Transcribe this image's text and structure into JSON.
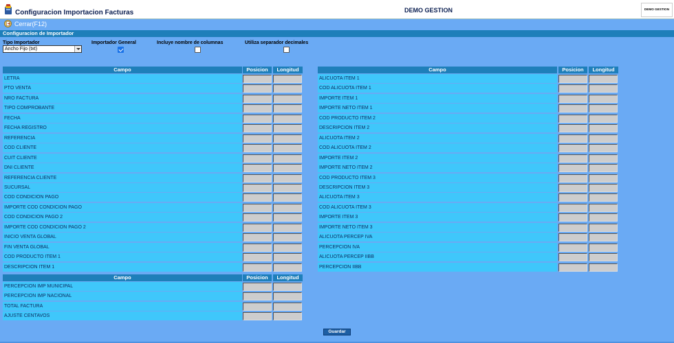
{
  "header": {
    "title": "Configuracion Importacion Facturas",
    "company": "DEMO GESTION",
    "logo_text": "DEMO GESTION"
  },
  "toolbar": {
    "close_label": "Cerrar(F12)"
  },
  "section": {
    "title": "Configuracion de Importador"
  },
  "options": {
    "tipo_label": "Tipo Importador",
    "tipo_value": "Ancho Fijo (txt)",
    "general_label": "Importador General",
    "general_checked": true,
    "columnas_label": "Incluye nombre de columnas",
    "columnas_checked": false,
    "separador_label": "Utiliza separador decimales",
    "separador_checked": false
  },
  "columns": {
    "campo": "Campo",
    "posicion": "Posicion",
    "longitud": "Longitud"
  },
  "left_table": {
    "rows": [
      "LETRA",
      "PTO VENTA",
      "NRO FACTURA",
      "TIPO COMPROBANTE",
      "FECHA",
      "FECHA REGISTRO",
      "REFERENCIA",
      "COD CLIENTE",
      "CUIT CLIENTE",
      "DNI CLIENTE",
      "REFERENCIA CLIENTE",
      "SUCURSAL",
      "COD CONDICION PAGO",
      "IMPORTE COD CONDICION PAGO",
      "COD CONDICION PAGO 2",
      "IMPORTE COD CONDICION PAGO 2",
      "INICIO VENTA GLOBAL",
      "FIN VENTA GLOBAL",
      "COD PRODUCTO ITEM 1",
      "DESCRIPCION ITEM 1"
    ]
  },
  "bottom_table": {
    "rows": [
      "PERCEPCION IMP MUNICIPAL",
      "PERCEPCION IMP NACIONAL",
      "TOTAL FACTURA",
      "AJUSTE CENTAVOS"
    ]
  },
  "right_table": {
    "rows": [
      "ALICUOTA ITEM 1",
      "COD ALICUOTA ITEM 1",
      "IMPORTE ITEM 1",
      "IMPORTE NETO ITEM 1",
      "COD PRODUCTO ITEM 2",
      "DESCRIPCION ITEM 2",
      "ALICUOTA ITEM 2",
      "COD ALICUOTA ITEM 2",
      "IMPORTE ITEM 2",
      "IMPORTE NETO ITEM 2",
      "COD PRODUCTO ITEM 3",
      "DESCRIPCION ITEM 3",
      "ALICUOTA ITEM 3",
      "COD ALICUOTA ITEM 3",
      "IMPORTE ITEM 3",
      "IMPORTE NETO ITEM 3",
      "ALICUOTA PERCEP IVA",
      "PERCEPCION IVA",
      "ALICUOTA PERCEP IIBB",
      "PERCEPCION IIBB"
    ]
  },
  "actions": {
    "save_label": "Guardar"
  },
  "colors": {
    "page_bg": "#6aaaf4",
    "header_bar": "#1e7fba",
    "row_bg": "#3fc7fb",
    "input_bg": "#cdcdcd"
  },
  "icons": {
    "app": "books-icon",
    "close": "exit-icon"
  }
}
